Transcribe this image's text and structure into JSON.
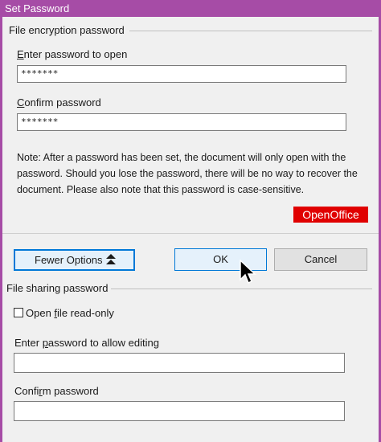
{
  "window": {
    "title": "Set Password"
  },
  "encryption": {
    "section_title": "File encryption password",
    "open_label_key": "E",
    "open_label_rest": "nter password to open",
    "open_value": "*******",
    "confirm_label_key": "C",
    "confirm_label_rest": "onfirm password",
    "confirm_value": "*******",
    "note": "Note: After a password has been set, the document will only open with the password. Should you lose the password, there will be no way to recover the document. Please also note that this password is case-sensitive."
  },
  "brand": {
    "text": "OpenOffice",
    "color": "#e00000"
  },
  "buttons": {
    "fewer_options": "Fewer Options",
    "ok": "OK",
    "cancel": "Cancel"
  },
  "sharing": {
    "section_title": "File sharing password",
    "readonly_pre": "Open ",
    "readonly_key": "f",
    "readonly_post": "ile read-only",
    "readonly_checked": false,
    "edit_label_pre": "Enter ",
    "edit_label_key": "p",
    "edit_label_post": "assword to allow editing",
    "edit_value": "",
    "confirm_label_pre": "Confi",
    "confirm_label_key": "r",
    "confirm_label_post": "m password",
    "confirm_value": ""
  },
  "colors": {
    "accent": "#a64ca6",
    "focus": "#0078d7"
  }
}
